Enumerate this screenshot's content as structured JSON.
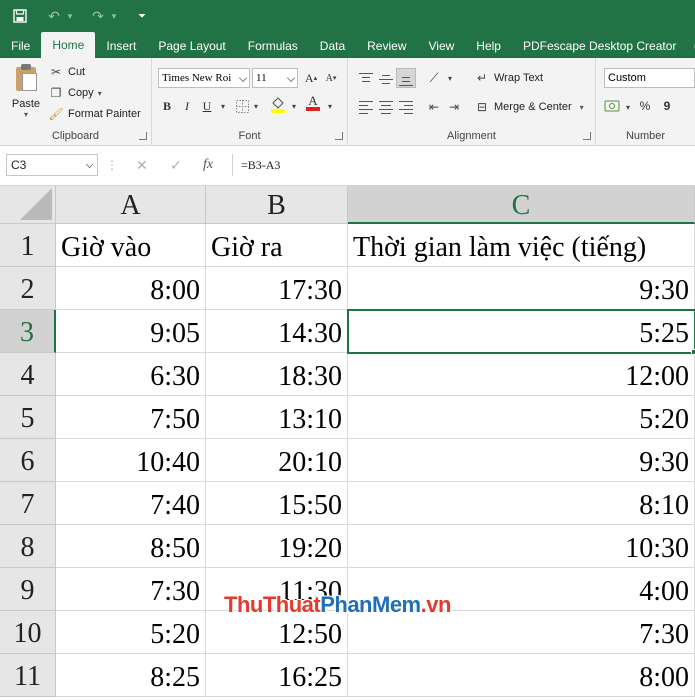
{
  "tabs": [
    "File",
    "Home",
    "Insert",
    "Page Layout",
    "Formulas",
    "Data",
    "Review",
    "View",
    "Help",
    "PDFescape Desktop Creator"
  ],
  "active_tab": "Home",
  "ribbon": {
    "clipboard": {
      "paste_label": "Paste",
      "cut_label": "Cut",
      "copy_label": "Copy",
      "format_painter_label": "Format Painter",
      "group_label": "Clipboard"
    },
    "font": {
      "font_name": "Times New Roi",
      "font_size": "11",
      "bold": "B",
      "italic": "I",
      "underline": "U",
      "grow": "A",
      "shrink": "A",
      "font_color": "A",
      "group_label": "Font"
    },
    "alignment": {
      "wrap_text_label": "Wrap Text",
      "merge_label": "Merge & Center",
      "group_label": "Alignment"
    },
    "number": {
      "format": "Custom",
      "percent": "%",
      "comma": "9",
      "group_label": "Number"
    }
  },
  "formula_bar": {
    "name_box": "C3",
    "formula": "=B3-A3",
    "fx": "fx"
  },
  "sheet": {
    "columns": [
      "A",
      "B",
      "C"
    ],
    "selected_column": "C",
    "selected_row": "3",
    "row_numbers": [
      "1",
      "2",
      "3",
      "4",
      "5",
      "6",
      "7",
      "8",
      "9",
      "10",
      "11"
    ],
    "rows": [
      [
        "Giờ vào",
        "Giờ ra",
        "Thời gian làm việc (tiếng)"
      ],
      [
        "8:00",
        "17:30",
        "9:30"
      ],
      [
        "9:05",
        "14:30",
        "5:25"
      ],
      [
        "6:30",
        "18:30",
        "12:00"
      ],
      [
        "7:50",
        "13:10",
        "5:20"
      ],
      [
        "10:40",
        "20:10",
        "9:30"
      ],
      [
        "7:40",
        "15:50",
        "8:10"
      ],
      [
        "8:50",
        "19:20",
        "10:30"
      ],
      [
        "7:30",
        "11:30",
        "4:00"
      ],
      [
        "5:20",
        "12:50",
        "7:30"
      ],
      [
        "8:25",
        "16:25",
        "8:00"
      ]
    ]
  },
  "watermark": {
    "part1": "ThuThuat",
    "part2": "PhanMem",
    "part3": ".vn"
  },
  "colors": {
    "excel_green": "#217346",
    "ribbon_bg": "#f3f3f3",
    "header_bg": "#e6e6e6"
  }
}
